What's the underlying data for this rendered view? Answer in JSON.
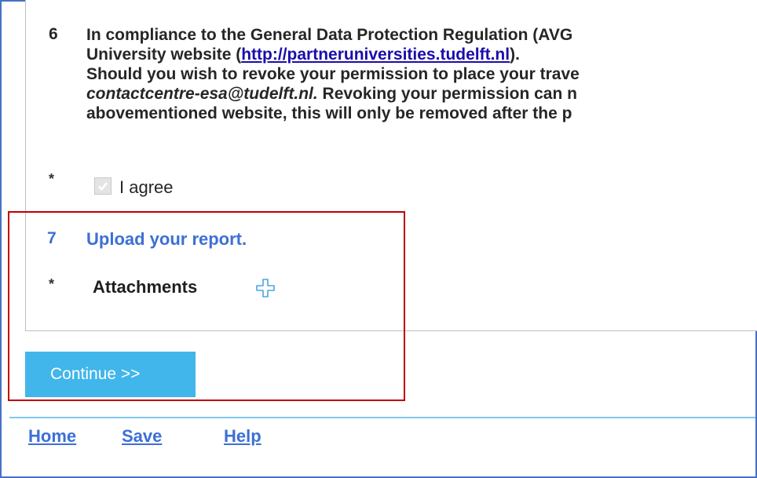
{
  "question6": {
    "number": "6",
    "line1": "In compliance to the General Data Protection Regulation (AVG",
    "line2_prefix": "University website (",
    "link_text": "http://partneruniversities.tudelft.nl",
    "line2_suffix": ").",
    "line3": "Should you wish to revoke your permission to place your trave",
    "email": "contactcentre-esa@tudelft.nl.",
    "line4_suffix": " Revoking your permission can n",
    "line5": "abovementioned website, this will only be removed after the p"
  },
  "agree": {
    "required_marker": "*",
    "label": "I agree",
    "checked": true
  },
  "question7": {
    "number": "7",
    "text": "Upload your report."
  },
  "attachments": {
    "required_marker": "*",
    "label": "Attachments",
    "add_icon": "plus-icon"
  },
  "continue_label": "Continue >>",
  "footer": {
    "home": "Home",
    "save": "Save",
    "help": "Help"
  },
  "colors": {
    "accent_blue": "#3d6fd6",
    "button_blue": "#41b6ea",
    "highlight_red": "#c00000",
    "frame_blue": "#4472c4"
  }
}
